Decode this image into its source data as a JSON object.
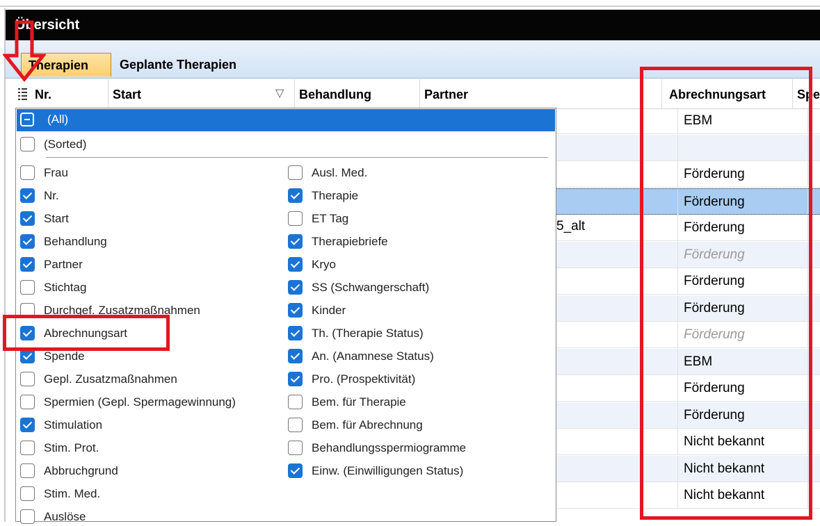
{
  "window": {
    "title": "Übersicht"
  },
  "tabs": [
    {
      "label": "Therapien",
      "active": true
    },
    {
      "label": "Geplante Therapien",
      "active": false
    }
  ],
  "grid": {
    "columns": [
      "Nr.",
      "Start",
      "Behandlung",
      "Partner",
      "Abrechnungsart",
      "Spe"
    ],
    "partial_text": "5_alt",
    "abrechnungsart": [
      {
        "value": "EBM",
        "dim": false
      },
      {
        "value": "",
        "dim": false
      },
      {
        "value": "Förderung",
        "dim": false
      },
      {
        "value": "Förderung",
        "dim": false,
        "selected": true
      },
      {
        "value": "Förderung",
        "dim": false
      },
      {
        "value": "Förderung",
        "dim": true
      },
      {
        "value": "Förderung",
        "dim": false
      },
      {
        "value": "Förderung",
        "dim": false
      },
      {
        "value": "Förderung",
        "dim": true
      },
      {
        "value": "EBM",
        "dim": false
      },
      {
        "value": "Förderung",
        "dim": false
      },
      {
        "value": "Förderung",
        "dim": false
      },
      {
        "value": "Nicht bekannt",
        "dim": false
      },
      {
        "value": "Nicht bekannt",
        "dim": false
      },
      {
        "value": "Nicht bekannt",
        "dim": false
      }
    ]
  },
  "column_chooser": {
    "all_label": "(All)",
    "sorted_label": "(Sorted)",
    "left_items": [
      {
        "label": "Frau",
        "checked": false
      },
      {
        "label": "Nr.",
        "checked": true
      },
      {
        "label": "Start",
        "checked": true
      },
      {
        "label": "Behandlung",
        "checked": true
      },
      {
        "label": "Partner",
        "checked": true
      },
      {
        "label": "Stichtag",
        "checked": false
      },
      {
        "label": "Durchgef. Zusatzmaßnahmen",
        "checked": false
      },
      {
        "label": "Abrechnungsart",
        "checked": true
      },
      {
        "label": "Spende",
        "checked": true
      },
      {
        "label": "Gepl. Zusatzmaßnahmen",
        "checked": false
      },
      {
        "label": "Spermien (Gepl. Spermagewinnung)",
        "checked": false
      },
      {
        "label": "Stimulation",
        "checked": true
      },
      {
        "label": "Stim. Prot.",
        "checked": false
      },
      {
        "label": "Abbruchgrund",
        "checked": false
      },
      {
        "label": "Stim. Med.",
        "checked": false
      },
      {
        "label": "Auslöse",
        "checked": false
      }
    ],
    "right_items": [
      {
        "label": "Ausl. Med.",
        "checked": false
      },
      {
        "label": "Therapie",
        "checked": true
      },
      {
        "label": "ET Tag",
        "checked": false
      },
      {
        "label": "Therapiebriefe",
        "checked": true
      },
      {
        "label": "Kryo",
        "checked": true
      },
      {
        "label": "SS (Schwangerschaft)",
        "checked": true
      },
      {
        "label": "Kinder",
        "checked": true
      },
      {
        "label": "Th. (Therapie Status)",
        "checked": true
      },
      {
        "label": "An. (Anamnese Status)",
        "checked": true
      },
      {
        "label": "Pro. (Prospektivität)",
        "checked": true
      },
      {
        "label": "Bem. für Therapie",
        "checked": false
      },
      {
        "label": "Bem. für Abrechnung",
        "checked": false
      },
      {
        "label": "Behandlungsspermiogramme",
        "checked": false
      },
      {
        "label": "Einw. (Einwilligungen Status)",
        "checked": true
      }
    ]
  },
  "colors": {
    "selection": "#1b74d4",
    "highlight_red": "#e4161f",
    "title_bar": "#050505",
    "tab_active": "#fbcf6e"
  }
}
